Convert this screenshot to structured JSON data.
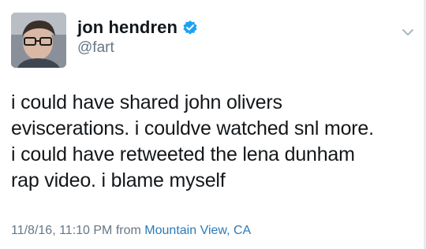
{
  "author": {
    "display_name": "jon hendren",
    "handle": "@fart",
    "verified_icon": "verified-badge-icon",
    "avatar": "avatar-photo"
  },
  "tweet": {
    "text_lines": [
      "i could have shared john olivers",
      "eviscerations. i couldve watched snl more.",
      "i could have retweeted the lena dunham",
      "rap video. i blame myself"
    ]
  },
  "meta": {
    "timestamp": "11/8/16, 11:10 PM",
    "from_label": "from",
    "location": "Mountain View, CA"
  },
  "menu": {
    "icon": "chevron-down-icon"
  },
  "colors": {
    "text": "#14171a",
    "secondary": "#657786",
    "link": "#2b7bb9",
    "verified": "#1da1f2"
  }
}
